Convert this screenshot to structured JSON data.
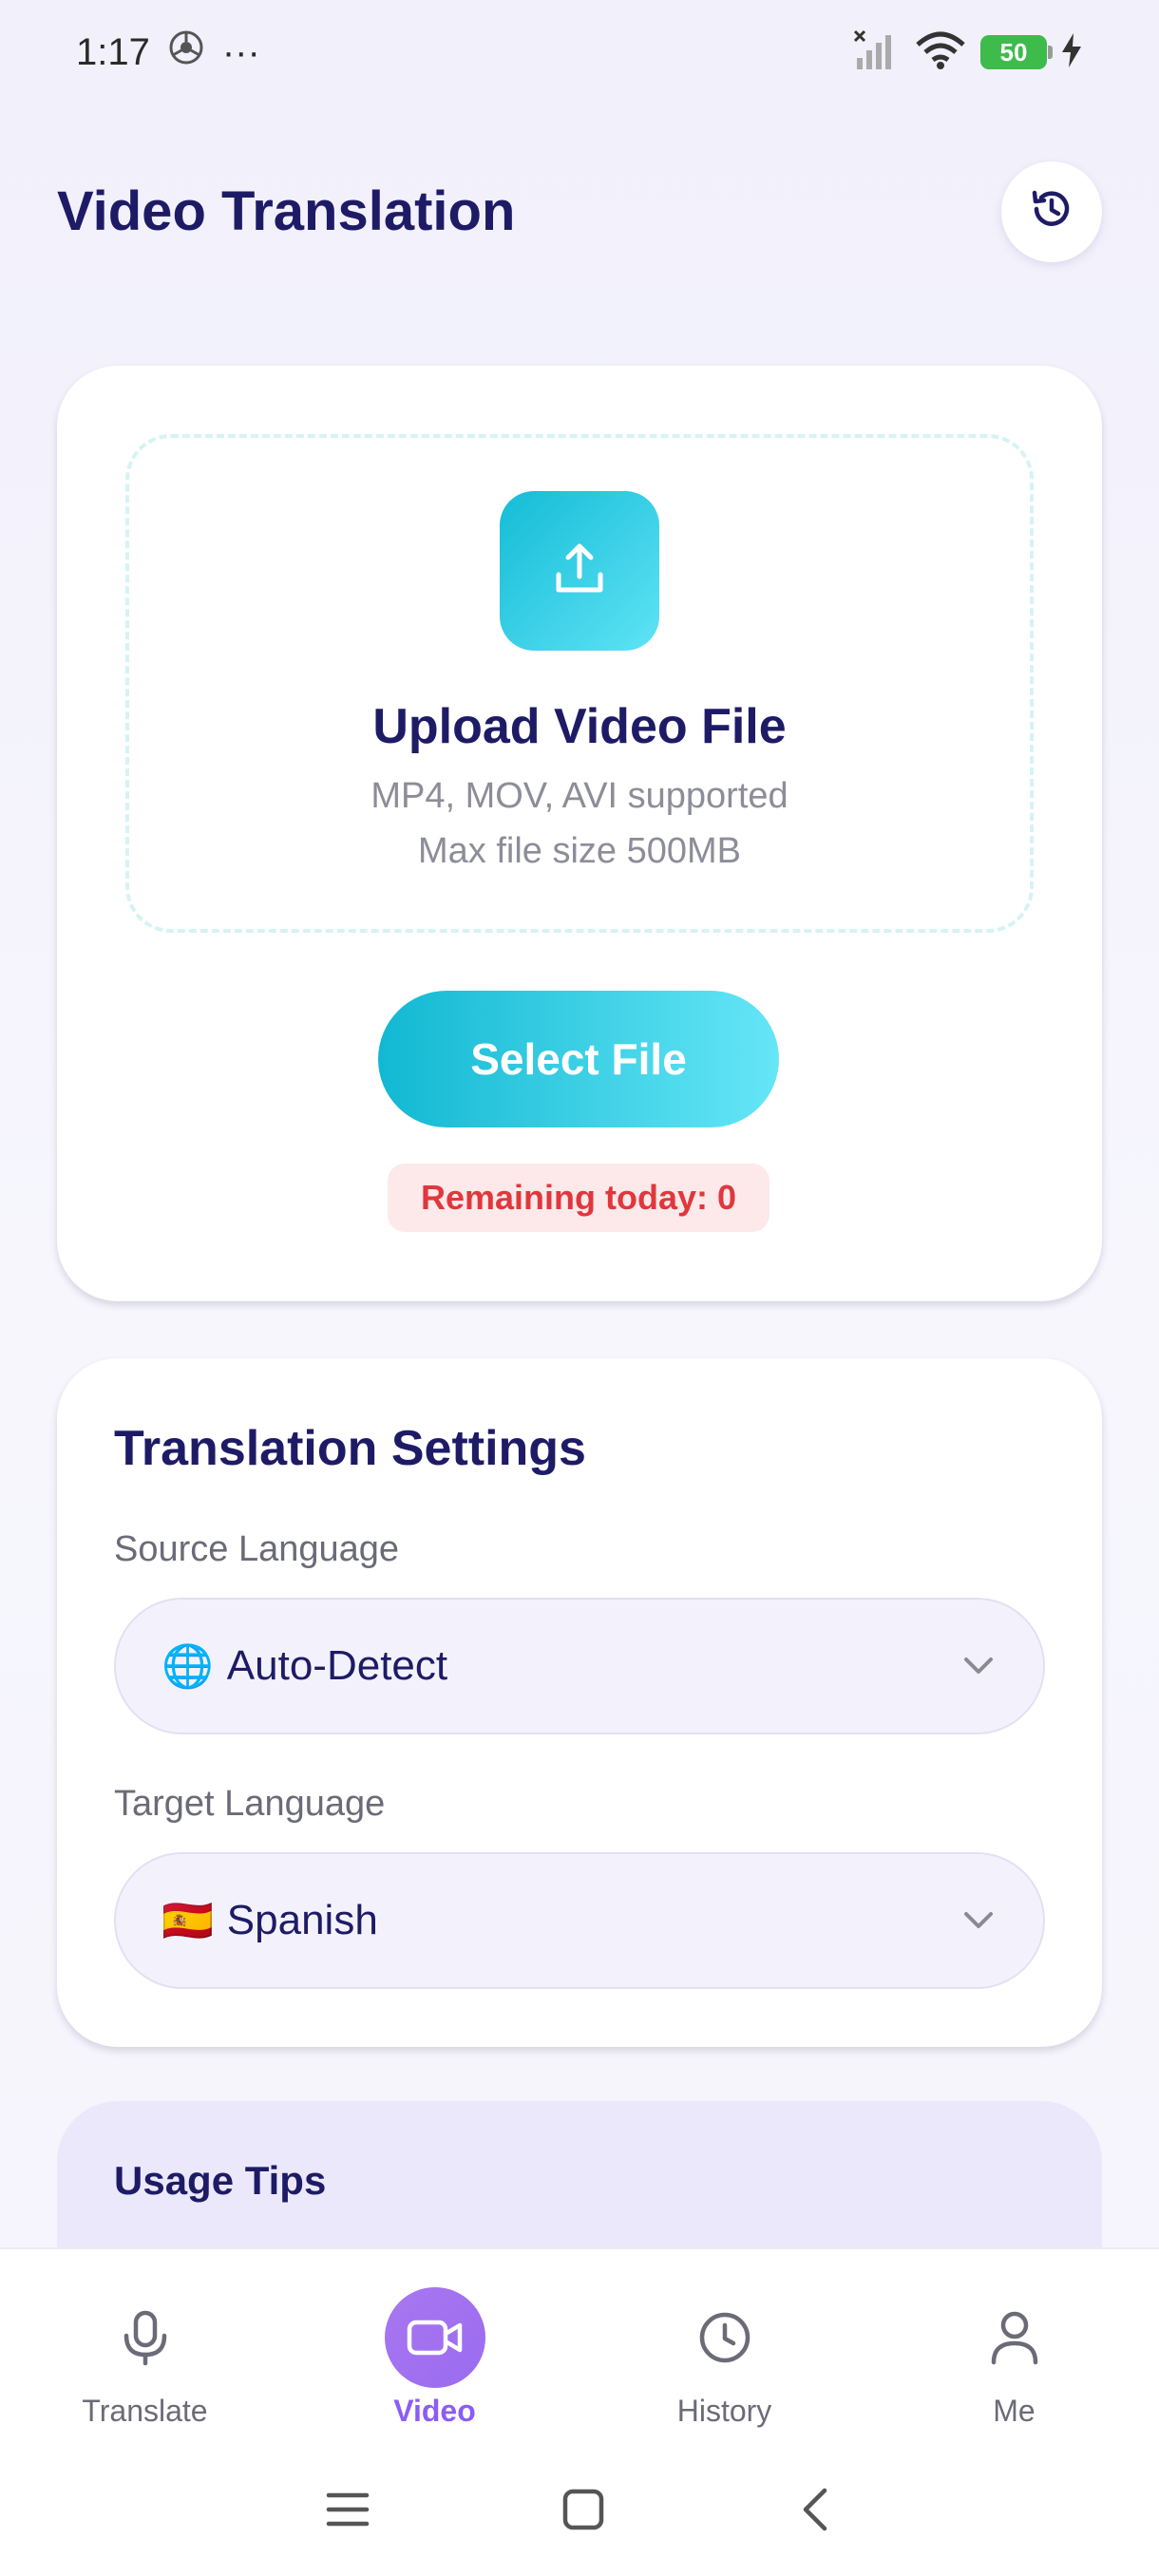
{
  "status_bar": {
    "time": "1:17",
    "dots": "···",
    "battery": "50"
  },
  "header": {
    "title": "Video Translation"
  },
  "upload": {
    "title": "Upload Video File",
    "formats": "MP4, MOV, AVI supported",
    "max_size": "Max file size 500MB",
    "select_button": "Select File",
    "remaining": "Remaining today: 0"
  },
  "settings": {
    "title": "Translation Settings",
    "source_label": "Source Language",
    "source_flag": "🌐",
    "source_value": "Auto-Detect",
    "target_label": "Target Language",
    "target_flag": "🇪🇸",
    "target_value": "Spanish"
  },
  "tips": {
    "title": "Usage Tips"
  },
  "nav": {
    "items": [
      {
        "label": "Translate",
        "icon": "microphone-icon",
        "active": false
      },
      {
        "label": "Video",
        "icon": "video-camera-icon",
        "active": true
      },
      {
        "label": "History",
        "icon": "clock-icon",
        "active": false
      },
      {
        "label": "Me",
        "icon": "user-icon",
        "active": false
      }
    ]
  },
  "colors": {
    "accent_cyan": "#14bcd6",
    "accent_purple": "#9b6bf0",
    "title_navy": "#1e1b66",
    "warning_red": "#e0373d"
  }
}
